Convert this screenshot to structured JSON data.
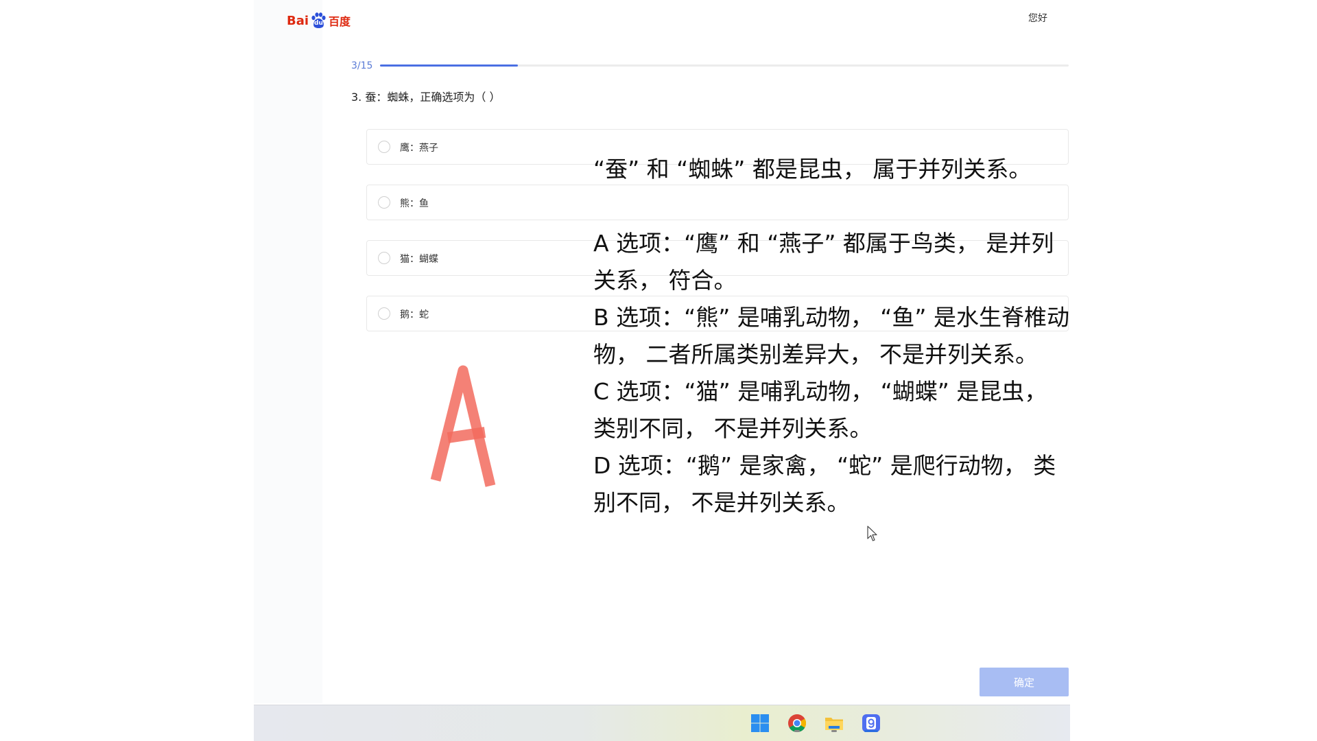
{
  "header": {
    "logo_text_latin": "Bai",
    "logo_text_du": "du",
    "logo_text_cn": "百度",
    "greeting": "您好"
  },
  "progress": {
    "label": "3/15",
    "current": 3,
    "total": 15
  },
  "question": {
    "text": "3. 蚕：蜘蛛，正确选项为（ ）",
    "options": [
      {
        "label": "鹰：燕子"
      },
      {
        "label": "熊：鱼"
      },
      {
        "label": "猫：蝴蝶"
      },
      {
        "label": "鹅：蛇"
      }
    ]
  },
  "answer_mark": "A",
  "explanation": {
    "intro": "“蚕” 和 “蜘蛛” 都是昆虫， 属于并列关系。",
    "lines": [
      "A 选项：“鹰” 和 “燕子” 都属于鸟类， 是并列关系， 符合。",
      "B 选项：“熊” 是哺乳动物， “鱼” 是水生脊椎动物， 二者所属类别差异大， 不是并列关系。",
      "C 选项：“猫” 是哺乳动物， “蝴蝶” 是昆虫， 类别不同， 不是并列关系。",
      "D 选项：“鹅” 是家禽， “蛇” 是爬行动物， 类别不同， 不是并列关系。"
    ]
  },
  "footer": {
    "confirm_label": "确定"
  },
  "taskbar": {
    "icons": [
      "windows-start-icon",
      "chrome-icon",
      "file-explorer-icon",
      "app-icon"
    ]
  },
  "colors": {
    "accent": "#4a6fe3",
    "button": "#a8bdf3",
    "answer_mark": "#f26b5e",
    "brand_red": "#de2910"
  }
}
